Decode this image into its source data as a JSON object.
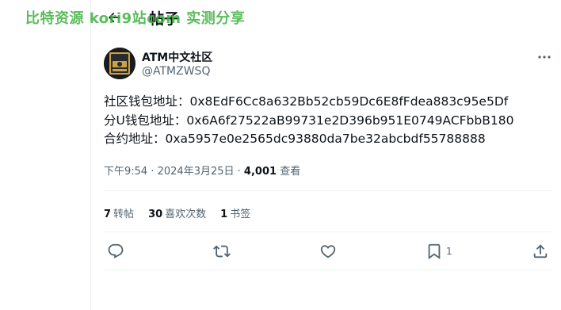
{
  "watermark": "比特资源 kori9站com 实测分享",
  "header": {
    "title": "帖子"
  },
  "author": {
    "display_name": "ATM中文社区",
    "handle": "@ATMZWSQ",
    "avatar_text": "ATM"
  },
  "post": {
    "lines": [
      "社区钱包地址：0x8EdF6Cc8a632Bb52cb59Dc6E8fFdea883c95e5Df",
      "分U钱包地址：0x6A6f27522aB99731e2D396b951E0749ACFbbB180",
      "合约地址：0xa5957e0e2565dc93880da7be32abcbdf55788888"
    ]
  },
  "meta": {
    "time": "下午9:54",
    "date": "2024年3月25日",
    "views_count": "4,001",
    "views_label": "查看"
  },
  "stats": [
    {
      "num": "7",
      "label": "转帖"
    },
    {
      "num": "30",
      "label": "喜欢次数"
    },
    {
      "num": "1",
      "label": "书签"
    }
  ],
  "actions": {
    "bookmark_count": "1"
  },
  "colors": {
    "text": "#0f1419",
    "secondary": "#536471",
    "divider": "#eff3f4",
    "watermark": "#3fb13f"
  }
}
